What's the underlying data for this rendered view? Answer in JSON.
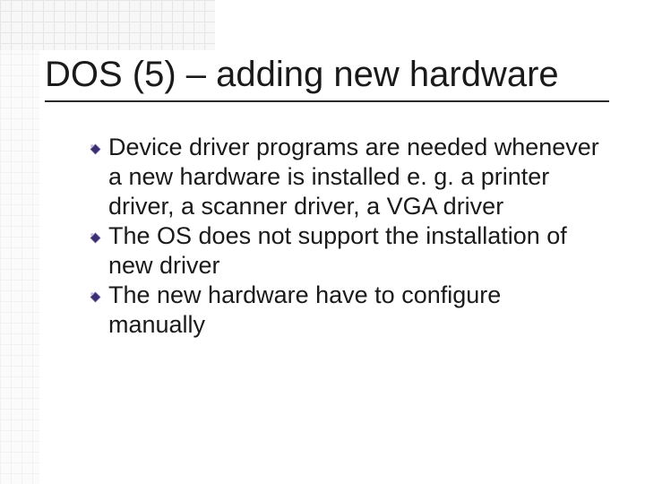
{
  "title": "DOS (5) – adding new hardware",
  "bullets": [
    "Device driver programs are needed whenever a new hardware is installed e. g. a printer driver, a scanner driver, a VGA driver",
    "The OS does not support the installation of new driver",
    "The new hardware have to configure manually"
  ]
}
